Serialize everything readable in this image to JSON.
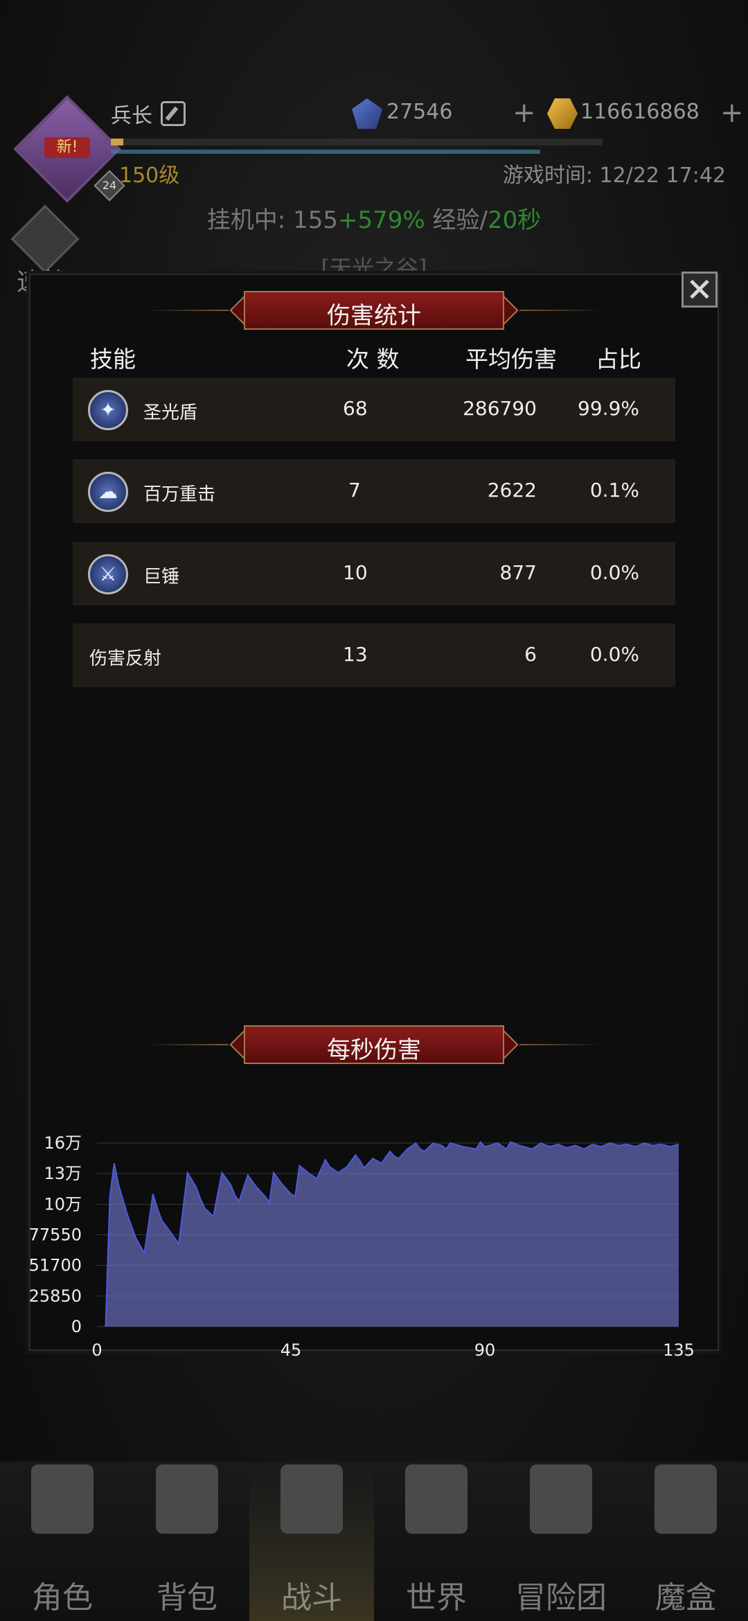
{
  "header": {
    "avatar_badge": "新!",
    "avatar_level": "24",
    "player_name": "兵长",
    "player_level": "150级",
    "game_time": "游戏时间: 12/22 17:42",
    "gems": "27546",
    "gold": "116616868",
    "afk_prefix": "挂机中: 155",
    "afk_bonus": "+579%",
    "afk_mid": " 经验/",
    "afk_rate": "20秒",
    "quick_battle": "速战",
    "zone": "[天光之谷]"
  },
  "damage_panel": {
    "title": "伤害统计",
    "columns": [
      "技能",
      "次 数",
      "平均伤害",
      "占比"
    ],
    "rows": [
      {
        "name": "圣光盾",
        "icon": "shield-icon",
        "count": "68",
        "avg": "286790",
        "share": "99.9%"
      },
      {
        "name": "百万重击",
        "icon": "mushroom-cloud-icon",
        "count": "7",
        "avg": "2622",
        "share": "0.1%"
      },
      {
        "name": "巨锤",
        "icon": "sword-icon",
        "count": "10",
        "avg": "877",
        "share": "0.0%"
      },
      {
        "name": "伤害反射",
        "icon": "",
        "count": "13",
        "avg": "6",
        "share": "0.0%"
      }
    ]
  },
  "dps_title": "每秒伤害",
  "chart_data": {
    "type": "area",
    "title": "每秒伤害",
    "xlabel": "",
    "ylabel": "",
    "xlim": [
      0,
      135
    ],
    "ylim": [
      0,
      155100
    ],
    "x_ticks": [
      "0",
      "45",
      "90",
      "135"
    ],
    "y_ticks": [
      "0",
      "25850",
      "51700",
      "77550",
      "10万",
      "13万",
      "16万"
    ],
    "y_tick_values": [
      0,
      25850,
      51700,
      77550,
      103400,
      129250,
      155100
    ],
    "grid": true,
    "color": "#6f74c8",
    "series": [
      {
        "x": [
          2,
          3,
          4,
          5,
          7,
          9,
          11,
          13,
          14,
          15,
          17,
          19,
          21,
          23,
          24,
          25,
          27,
          29,
          31,
          32,
          33,
          35,
          37,
          39,
          40,
          41,
          43,
          45,
          46,
          47,
          49,
          51,
          53,
          54,
          56,
          58,
          60,
          61,
          62,
          64,
          66,
          68,
          69,
          70,
          72,
          74,
          75,
          76,
          78,
          80,
          81,
          82,
          85,
          88,
          89,
          90,
          93,
          95,
          96,
          98,
          101,
          103,
          105,
          107,
          109,
          111,
          113,
          115,
          117,
          119,
          121,
          123,
          125,
          127,
          129,
          131,
          133,
          135
        ],
        "values": [
          0,
          110000,
          138000,
          120000,
          95000,
          75000,
          62000,
          112000,
          100000,
          90000,
          80000,
          70000,
          130000,
          118000,
          108000,
          100000,
          93000,
          130000,
          120000,
          111000,
          106000,
          128000,
          118000,
          110000,
          105000,
          130000,
          120000,
          112000,
          110000,
          136000,
          130000,
          125000,
          141000,
          135000,
          130000,
          135000,
          145000,
          140000,
          134000,
          142000,
          138000,
          148000,
          144000,
          142000,
          150000,
          155000,
          150000,
          148000,
          155000,
          153000,
          150000,
          155000,
          152000,
          150000,
          156000,
          152000,
          155000,
          150000,
          156000,
          153000,
          150000,
          155000,
          152000,
          154000,
          151000,
          153000,
          150000,
          154000,
          152000,
          155000,
          153000,
          154000,
          152000,
          155000,
          153000,
          154000,
          152000,
          154000
        ]
      }
    ]
  },
  "nav": {
    "items": [
      "角色",
      "背包",
      "战斗",
      "世界",
      "冒险团",
      "魔盒"
    ],
    "active": "战斗"
  }
}
